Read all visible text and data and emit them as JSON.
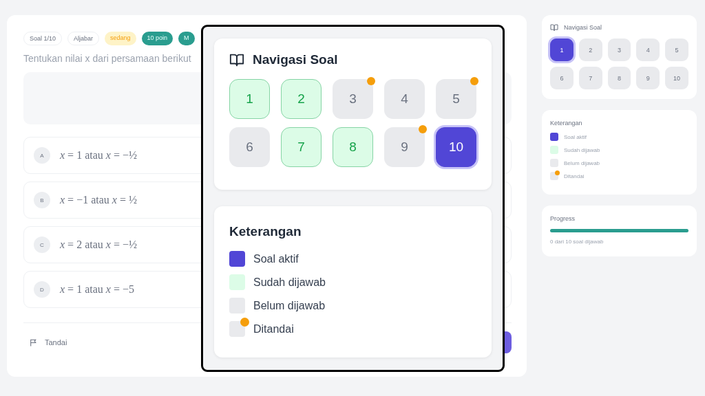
{
  "question": {
    "chips": [
      {
        "text": "Soal 1/10",
        "kind": "plain"
      },
      {
        "text": "Aljabar",
        "kind": "plain"
      },
      {
        "text": "sedang",
        "kind": "level"
      },
      {
        "text": "10 poin",
        "kind": "points"
      },
      {
        "text": "M",
        "kind": "points"
      }
    ],
    "text": "Tentukan nilai x dari persamaan berikut",
    "options": [
      {
        "letter": "A",
        "text": "*x* = 1 atau *x* = −½"
      },
      {
        "letter": "B",
        "text": "*x* = −1 atau *x* = ½"
      },
      {
        "letter": "C",
        "text": "*x* = 2 atau *x* = −½"
      },
      {
        "letter": "D",
        "text": "*x* = 1 atau *x* = −5"
      }
    ],
    "flag_button": "Tandai"
  },
  "sidebar": {
    "navigation": {
      "title": "Navigasi Soal",
      "items": [
        {
          "label": "1",
          "selected": true,
          "answered": false,
          "flagged": false
        },
        {
          "label": "2",
          "selected": false,
          "answered": false,
          "flagged": false
        },
        {
          "label": "3",
          "selected": false,
          "answered": false,
          "flagged": false
        },
        {
          "label": "4",
          "selected": false,
          "answered": false,
          "flagged": false
        },
        {
          "label": "5",
          "selected": false,
          "answered": false,
          "flagged": false
        },
        {
          "label": "6",
          "selected": false,
          "answered": false,
          "flagged": false
        },
        {
          "label": "7",
          "selected": false,
          "answered": false,
          "flagged": false
        },
        {
          "label": "8",
          "selected": false,
          "answered": false,
          "flagged": false
        },
        {
          "label": "9",
          "selected": false,
          "answered": false,
          "flagged": false
        },
        {
          "label": "10",
          "selected": false,
          "answered": false,
          "flagged": false
        }
      ]
    },
    "legend": {
      "title": "Keterangan",
      "items": [
        {
          "kind": "active",
          "label": "Soal aktif"
        },
        {
          "kind": "answered",
          "label": "Sudah dijawab"
        },
        {
          "kind": "unanswered",
          "label": "Belum dijawab"
        },
        {
          "kind": "flagged",
          "label": "Ditandai"
        }
      ]
    },
    "progress": {
      "title": "Progress",
      "level": 1,
      "caption": "0 dari 10 soal dijawab"
    }
  },
  "zoom_callout": {
    "navigation": {
      "title": "Navigasi Soal",
      "items": [
        {
          "label": "1",
          "selected": false,
          "answered": true,
          "flagged": false
        },
        {
          "label": "2",
          "selected": false,
          "answered": true,
          "flagged": false
        },
        {
          "label": "3",
          "selected": false,
          "answered": false,
          "flagged": true
        },
        {
          "label": "4",
          "selected": false,
          "answered": false,
          "flagged": false
        },
        {
          "label": "5",
          "selected": false,
          "answered": false,
          "flagged": true
        },
        {
          "label": "6",
          "selected": false,
          "answered": false,
          "flagged": false
        },
        {
          "label": "7",
          "selected": false,
          "answered": true,
          "flagged": false
        },
        {
          "label": "8",
          "selected": false,
          "answered": true,
          "flagged": false
        },
        {
          "label": "9",
          "selected": false,
          "answered": false,
          "flagged": true
        },
        {
          "label": "10",
          "selected": true,
          "answered": false,
          "flagged": false
        }
      ]
    },
    "legend": {
      "title": "Keterangan",
      "items": [
        {
          "kind": "active",
          "label": "Soal aktif"
        },
        {
          "kind": "answered",
          "label": "Sudah dijawab"
        },
        {
          "kind": "unanswered",
          "label": "Belum dijawab"
        },
        {
          "kind": "flagged",
          "label": "Ditandai"
        }
      ]
    }
  }
}
